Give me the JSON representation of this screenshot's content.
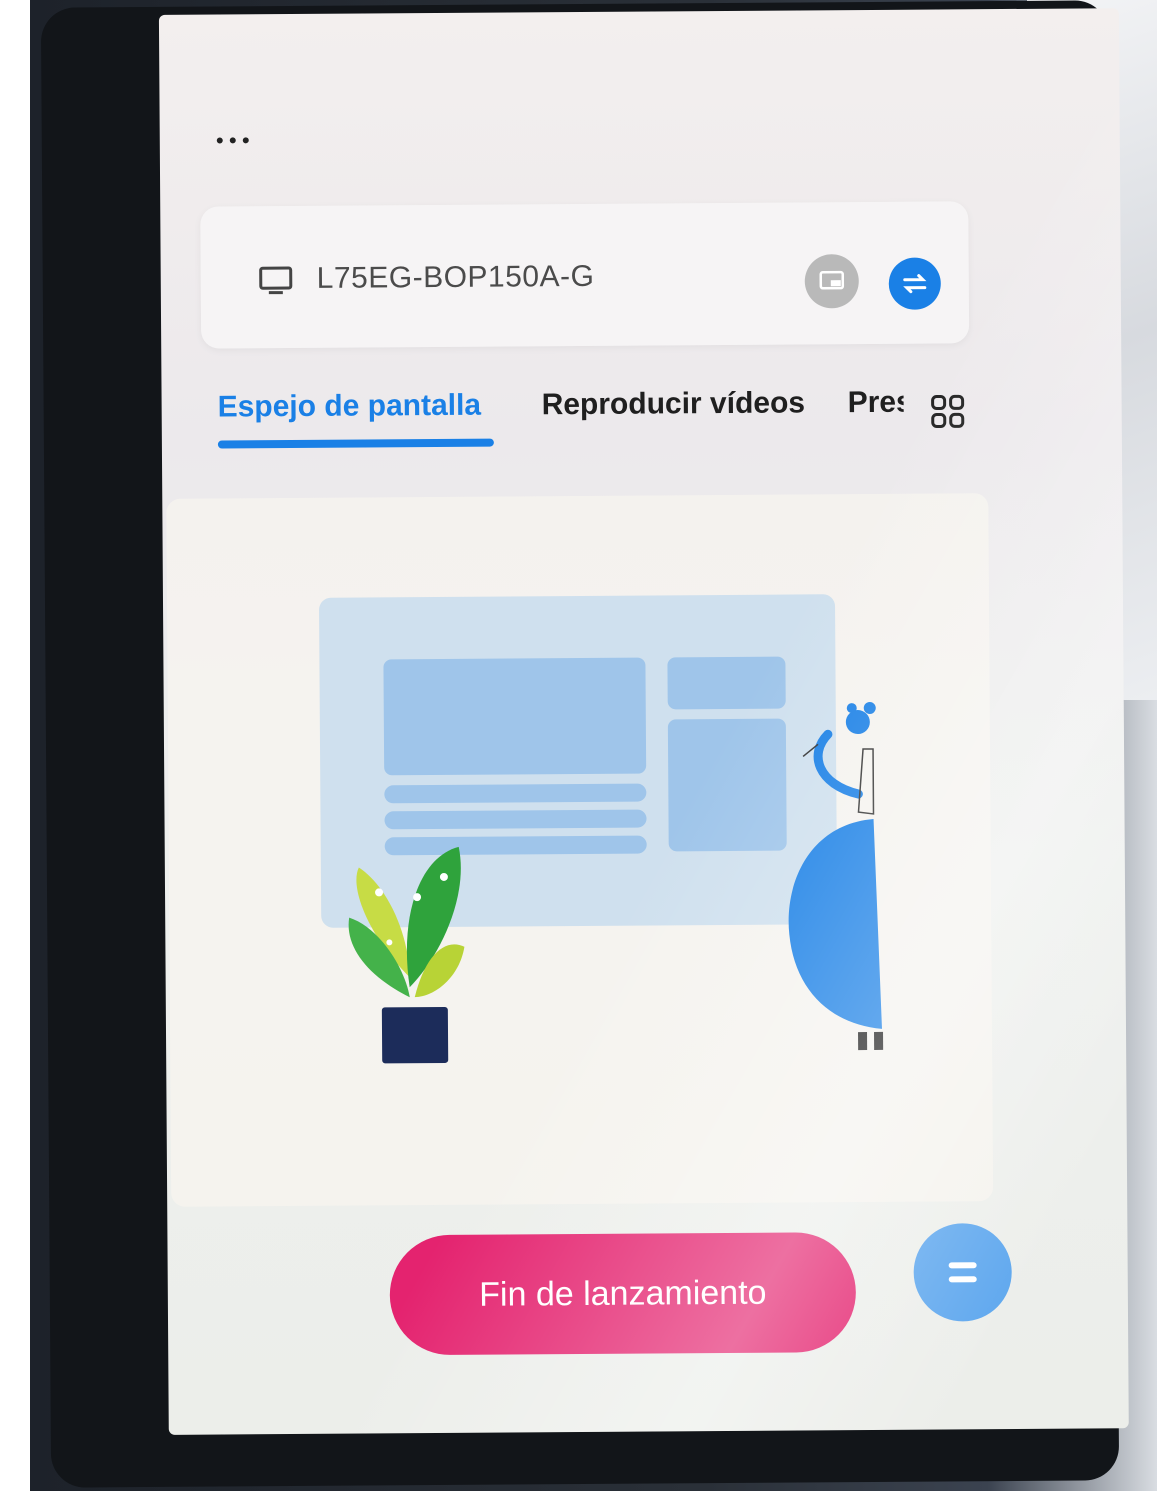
{
  "header": {
    "more_icon": "more-horizontal-icon"
  },
  "device": {
    "name": "L75EG-BOP150A-G",
    "device_icon": "tv-icon",
    "cast_icon": "cast-icon",
    "switch_icon": "switch-icon"
  },
  "tabs": [
    {
      "label": "Espejo de pantalla",
      "active": true
    },
    {
      "label": "Reproducir vídeos",
      "active": false
    },
    {
      "label": "Pres",
      "active": false
    }
  ],
  "tabs_grid_icon": "grid-icon",
  "illustration": "screen-mirroring-illustration",
  "actions": {
    "end_label": "Fin de lanzamiento",
    "menu_icon": "menu-icon"
  },
  "colors": {
    "accent_blue": "#1a80e6",
    "end_button_pink": "#e4236f",
    "menu_fab_blue": "#5ea7ee"
  }
}
